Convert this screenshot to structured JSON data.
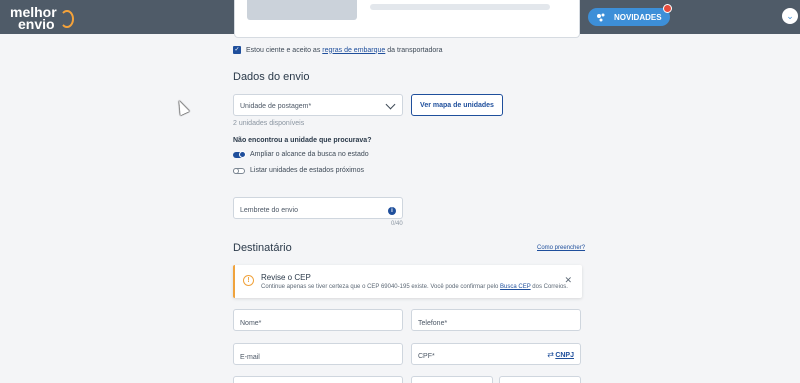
{
  "brand": {
    "logo_line1": "melhor",
    "logo_line2": "envio"
  },
  "header": {
    "novidades_label": "NOVIDADES",
    "scroll_icon": "chevron-down-icon"
  },
  "terms": {
    "prefix": "Estou ciente e aceito as ",
    "link": "regras de embarque",
    "suffix": " da transportadora"
  },
  "envio": {
    "title": "Dados do envio",
    "unit_select_label": "Unidade de postagem*",
    "map_button": "Ver mapa de unidades",
    "units_available": "2 unidades disponíveis",
    "not_found_question": "Não encontrou a unidade que procurava?",
    "toggle_expand": "Ampliar o alcance da busca no estado",
    "toggle_nearby": "Listar unidades de estados próximos",
    "reminder_label": "Lembrete do envio",
    "reminder_counter": "0/40"
  },
  "destinatario": {
    "title": "Destinatário",
    "how_to_fill_link": "Como preencher?",
    "alert": {
      "title": "Revise o CEP",
      "body_prefix": "Continue apenas se tiver certeza que o CEP 69040-195 existe. Você pode confirmar pelo ",
      "body_link": "Busca CEP",
      "body_suffix": " dos Correios.",
      "close": "✕"
    },
    "name_label": "Nome*",
    "phone_label": "Telefone*",
    "email_label": "E-mail",
    "cpf_label": "CPF*",
    "cnpj_link": "CNPJ"
  },
  "colors": {
    "header_bg": "#4f5b68",
    "primary": "#1f4f9c",
    "accent": "#3d8fd8",
    "warning": "#f0a33d"
  }
}
